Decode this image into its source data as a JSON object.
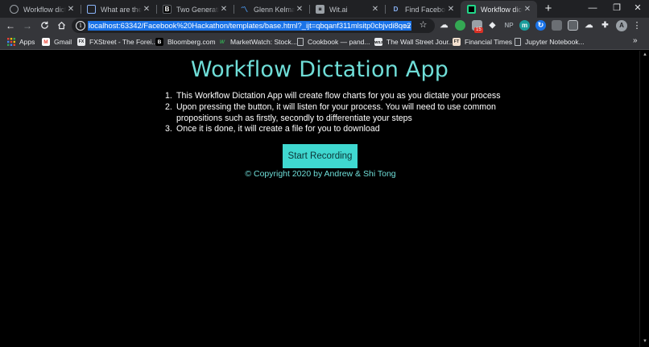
{
  "browser": {
    "tabs": [
      {
        "title": "Workflow dictati",
        "favicon": "globe-icon",
        "favicon_text": "",
        "favicon_color": "#5f6368",
        "active": false
      },
      {
        "title": "What are the te",
        "favicon": "page-icon",
        "favicon_text": "",
        "favicon_color": "#1a73e8",
        "active": false
      },
      {
        "title": "Two Generation",
        "favicon": "b-logo-icon",
        "favicon_text": "B",
        "favicon_color": "#000000",
        "active": false
      },
      {
        "title": "Glenn Kelman |",
        "favicon": "m-logo-icon",
        "favicon_text": "M",
        "favicon_color": "#1e88e5",
        "active": false
      },
      {
        "title": "Wit.ai",
        "favicon": "robot-icon",
        "favicon_text": "W",
        "favicon_color": "#9aa0a6",
        "active": false
      },
      {
        "title": "Find Facebook I",
        "favicon": "d-logo-icon",
        "favicon_text": "D",
        "favicon_color": "#202124",
        "active": false
      },
      {
        "title": "Workflow dictati",
        "favicon": "pycharm-icon",
        "favicon_text": "",
        "favicon_color": "#21d789",
        "active": true
      }
    ],
    "new_tab_glyph": "+",
    "window_controls": {
      "minimize": "—",
      "maximize": "❐",
      "close": "✕"
    },
    "nav": {
      "back": "←",
      "forward": "→",
      "reload": "C",
      "home": "⌂"
    },
    "url": "localhost:63342/Facebook%20Hackathon/templates/base.html?_ijt=qbqanf311mlsitp0cbjvdi8qo2",
    "info_glyph": "i",
    "star_glyph": "☆",
    "extensions": [
      {
        "name": "cloud-extension-icon",
        "text": "☁",
        "color": "#35363a"
      },
      {
        "name": "green-extension-icon",
        "text": "●",
        "color": "#34a853"
      },
      {
        "name": "calendar-extension-icon",
        "text": "",
        "color": "#5f6368",
        "badge": "15"
      },
      {
        "name": "diamond-extension-icon",
        "text": "◆",
        "color": "#35363a"
      },
      {
        "name": "np-extension-icon",
        "text": "NP",
        "color": "#35363a"
      },
      {
        "name": "m-extension-icon",
        "text": "m",
        "color": "#1a9c9c"
      },
      {
        "name": "refresh-extension-icon",
        "text": "↻",
        "color": "#1a73e8"
      },
      {
        "name": "grey-extension-icon",
        "text": "",
        "color": "#5f6368"
      },
      {
        "name": "image-extension-icon",
        "text": "▣",
        "color": "#5f6368"
      },
      {
        "name": "cloud2-extension-icon",
        "text": "☁",
        "color": "#35363a"
      },
      {
        "name": "puzzle-icon",
        "text": "✚",
        "color": "#35363a"
      }
    ],
    "profile_initial": "A",
    "menu_glyph": "⋮",
    "bookmarks": [
      {
        "label": "Apps",
        "icon": "apps-grid-icon",
        "icon_text": "⋮⋮",
        "color": "#ea4335"
      },
      {
        "label": "Gmail",
        "icon": "gmail-icon",
        "icon_text": "M",
        "color": "#ea4335"
      },
      {
        "label": "FXStreet - The Forei...",
        "icon": "fxstreet-icon",
        "icon_text": "FX",
        "color": "#5f6368"
      },
      {
        "label": "Bloomberg.com",
        "icon": "bloomberg-icon",
        "icon_text": "B",
        "color": "#000000"
      },
      {
        "label": "MarketWatch: Stock...",
        "icon": "marketwatch-icon",
        "icon_text": "W",
        "color": "#34a853"
      },
      {
        "label": "Cookbook — pand...",
        "icon": "document-icon",
        "icon_text": "",
        "color": "#9aa0a6"
      },
      {
        "label": "The Wall Street Jour...",
        "icon": "wsj-icon",
        "icon_text": "WSJ",
        "color": "#e8eaed"
      },
      {
        "label": "Financial Times",
        "icon": "ft-icon",
        "icon_text": "FT",
        "color": "#f2dfce"
      },
      {
        "label": "Jupyter Notebook...",
        "icon": "jupyter-icon",
        "icon_text": "",
        "color": "#9aa0a6"
      }
    ],
    "bookmarks_more": "»"
  },
  "page": {
    "title": "Workflow Dictation App",
    "steps": [
      {
        "num": "1.",
        "text": "This Workflow Dictation App will create flow charts for you as you dictate your process"
      },
      {
        "num": "2.",
        "text": "Upon pressing the button, it will listen for your process. You will need to use common propositions such as firstly, secondly to differentiate your steps"
      },
      {
        "num": "3.",
        "text": "Once it is done, it will create a file for you to download"
      }
    ],
    "record_button": "Start Recording",
    "copyright": "© Copyright 2020 by Andrew & Shi Tong",
    "accent_color": "#6fded8",
    "button_color": "#3fd8d0"
  }
}
